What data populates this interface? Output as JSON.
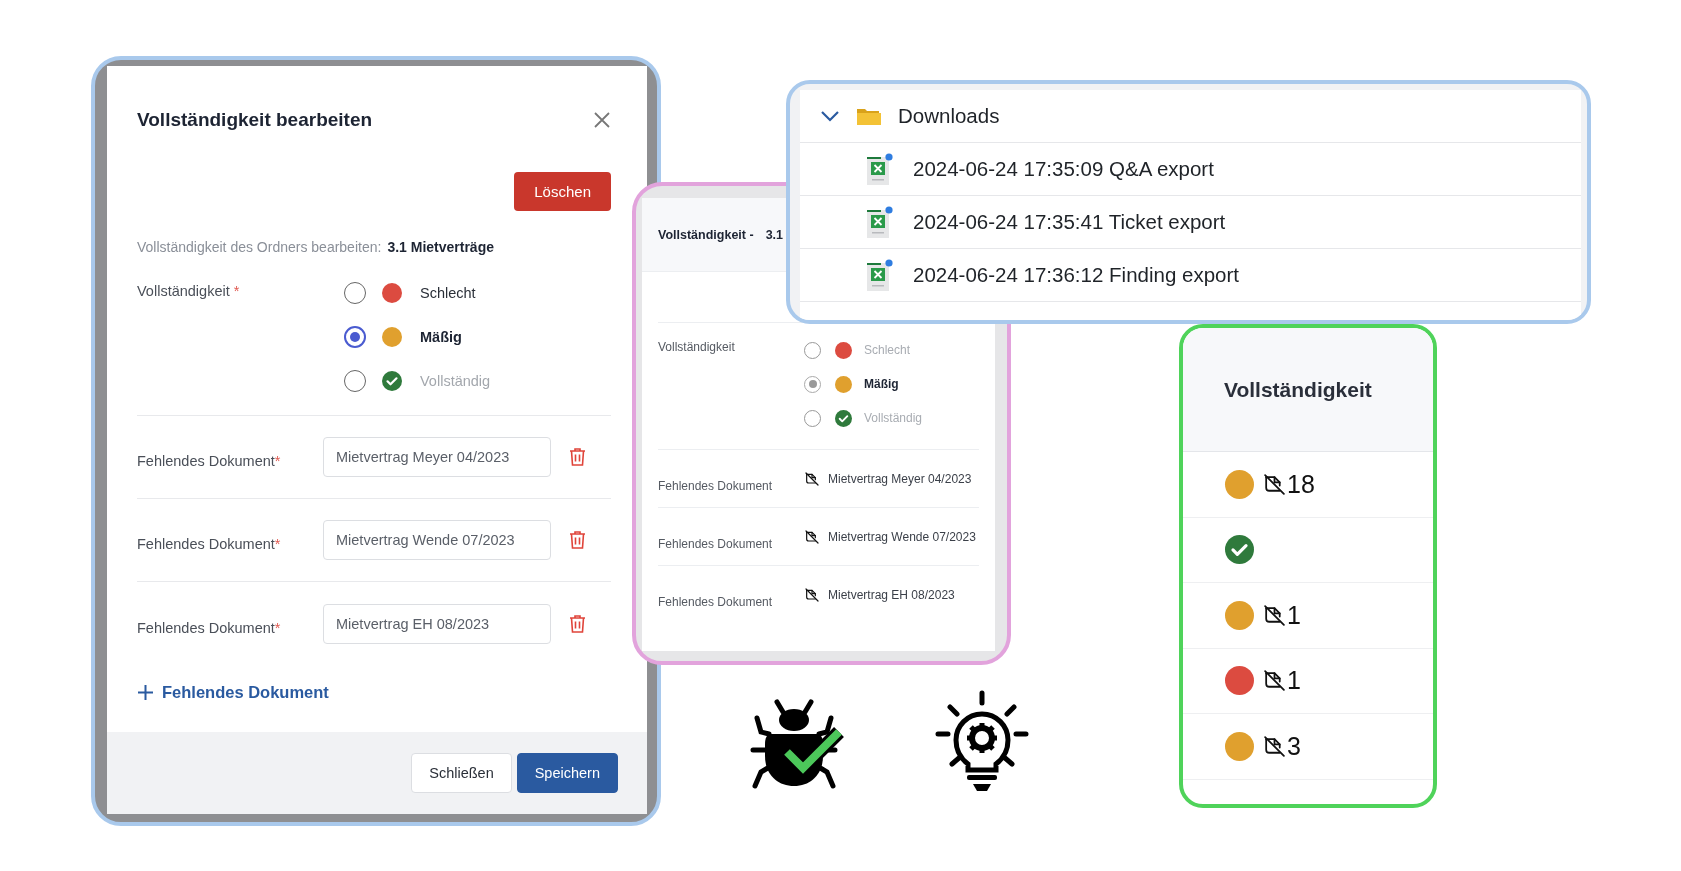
{
  "edit_dialog": {
    "title": "Vollständigkeit bearbeiten",
    "delete_button": "Löschen",
    "folder_label": "Vollständigkeit des Ordners bearbeiten:",
    "folder_name": "3.1 Mietverträge",
    "completeness_label": "Vollständigkeit",
    "required_mark": "*",
    "options": [
      {
        "label": "Schlecht",
        "kind": "dot",
        "color": "#dc4b40",
        "selected": false,
        "disabled": false
      },
      {
        "label": "Mäßig",
        "kind": "dot",
        "color": "#e0a02e",
        "selected": true,
        "disabled": false
      },
      {
        "label": "Vollständig",
        "kind": "check",
        "color": "#2f7a3c",
        "selected": false,
        "disabled": true
      }
    ],
    "missing_documents": [
      {
        "label": "Fehlendes Dokument",
        "required_mark": "*",
        "value": "Mietvertrag Meyer 04/2023"
      },
      {
        "label": "Fehlendes Dokument",
        "required_mark": "*",
        "value": "Mietvertrag Wende 07/2023"
      },
      {
        "label": "Fehlendes Dokument",
        "required_mark": "*",
        "value": "Mietvertrag EH 08/2023"
      }
    ],
    "add_link": "Fehlendes Dokument",
    "buttons": [
      {
        "label": "Schließen",
        "kind": "secondary"
      },
      {
        "label": "Speichern",
        "kind": "primary"
      }
    ]
  },
  "completeness_view": {
    "title": "Vollständigkeit -",
    "folder_name": "3.1",
    "completeness_label": "Vollständigkeit",
    "options": [
      {
        "label": "Schlecht",
        "kind": "dot",
        "color": "#dc4b40",
        "selected": false
      },
      {
        "label": "Mäßig",
        "kind": "dot",
        "color": "#e0a02e",
        "selected": true
      },
      {
        "label": "Vollständig",
        "kind": "check",
        "color": "#2f7a3c",
        "selected": false
      }
    ],
    "missing_documents": [
      {
        "label": "Fehlendes Dokument",
        "value": "Mietvertrag Meyer 04/2023"
      },
      {
        "label": "Fehlendes Dokument",
        "value": "Mietvertrag Wende 07/2023"
      },
      {
        "label": "Fehlendes Dokument",
        "value": "Mietvertrag EH 08/2023"
      }
    ]
  },
  "downloads": {
    "folder": {
      "label": "Downloads",
      "expanded": true
    },
    "files": [
      {
        "name": "2024-06-24 17:35:09 Q&A export"
      },
      {
        "name": "2024-06-24 17:35:41 Ticket export"
      },
      {
        "name": "2024-06-24 17:36:12 Finding export"
      }
    ]
  },
  "completeness_column": {
    "header": "Vollständigkeit",
    "rows": [
      {
        "kind": "dot",
        "color": "#e0a02e",
        "count": "18"
      },
      {
        "kind": "check",
        "color": "#2f7a3c"
      },
      {
        "kind": "dot",
        "color": "#e0a02e",
        "count": "1"
      },
      {
        "kind": "dot",
        "color": "#dc4b40",
        "count": "1"
      },
      {
        "kind": "dot",
        "color": "#e0a02e",
        "count": "3"
      }
    ]
  }
}
